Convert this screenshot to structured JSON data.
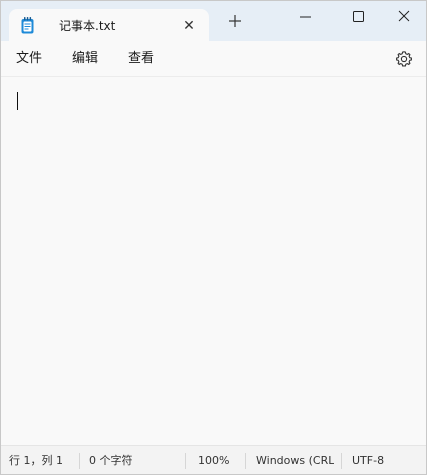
{
  "tab": {
    "title": "记事本.txt",
    "close_glyph": "✕",
    "icon": "notepad-icon"
  },
  "titlebar": {
    "new_tab_icon": "plus-icon",
    "minimize_icon": "minimize-icon",
    "maximize_icon": "maximize-icon",
    "close_icon": "close-icon"
  },
  "menu": {
    "file": "文件",
    "edit": "编辑",
    "view": "查看",
    "settings_icon": "gear-icon"
  },
  "editor": {
    "content": ""
  },
  "status": {
    "position": "行 1，列 1",
    "char_count": "0 个字符",
    "zoom": "100%",
    "line_ending": "Windows (CRLF)",
    "encoding": "UTF-8"
  },
  "colors": {
    "titlebar_bg": "#e6eef6",
    "window_bg": "#f9f9f9",
    "statusbar_bg": "#f3f3f3",
    "icon_accent": "#1e8ad8"
  }
}
